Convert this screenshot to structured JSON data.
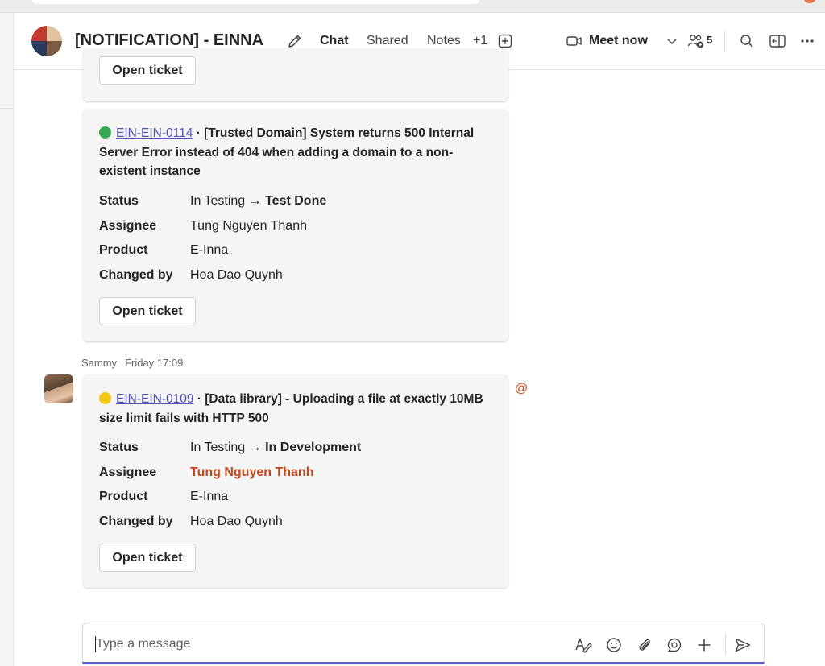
{
  "header": {
    "title": "[NOTIFICATION] - EINNA",
    "tabs": [
      {
        "label": "Chat",
        "active": true
      },
      {
        "label": "Shared",
        "active": false
      },
      {
        "label": "Notes",
        "active": false
      }
    ],
    "more_tabs": "+1",
    "meet_now_label": "Meet now",
    "participants_count": "5"
  },
  "messages": {
    "partial_card": {
      "button": "Open ticket"
    },
    "card_1": {
      "status_color": "#34a853",
      "ticket_id": "EIN-EIN-0114",
      "separator": " · ",
      "title": "[Trusted Domain] System returns 500 Internal Server Error instead of 404 when adding a domain to a non-existent instance",
      "fields": {
        "status_label": "Status",
        "status_from": "In Testing",
        "arrow": " → ",
        "status_to": "Test Done",
        "assignee_label": "Assignee",
        "assignee": "Tung Nguyen Thanh",
        "product_label": "Product",
        "product": "E-Inna",
        "changed_by_label": "Changed by",
        "changed_by": "Hoa Dao Quynh"
      },
      "button": "Open ticket"
    },
    "sender": {
      "name": "Sammy",
      "time": "Friday 17:09"
    },
    "mention_symbol": "@",
    "card_2": {
      "status_color": "#f5c518",
      "ticket_id": "EIN-EIN-0109",
      "separator": " · ",
      "title": "[Data library] - Uploading a file at exactly 10MB size limit fails with HTTP 500",
      "fields": {
        "status_label": "Status",
        "status_from": "In Testing",
        "arrow": " → ",
        "status_to": "In Development",
        "assignee_label": "Assignee",
        "assignee": "Tung Nguyen Thanh",
        "product_label": "Product",
        "product": "E-Inna",
        "changed_by_label": "Changed by",
        "changed_by": "Hoa Dao Quynh"
      },
      "button": "Open ticket"
    }
  },
  "composer": {
    "placeholder": "Type a message"
  },
  "colors": {
    "accent": "#5b5fc7",
    "link": "#4f52b2",
    "mention": "#c4461a"
  }
}
